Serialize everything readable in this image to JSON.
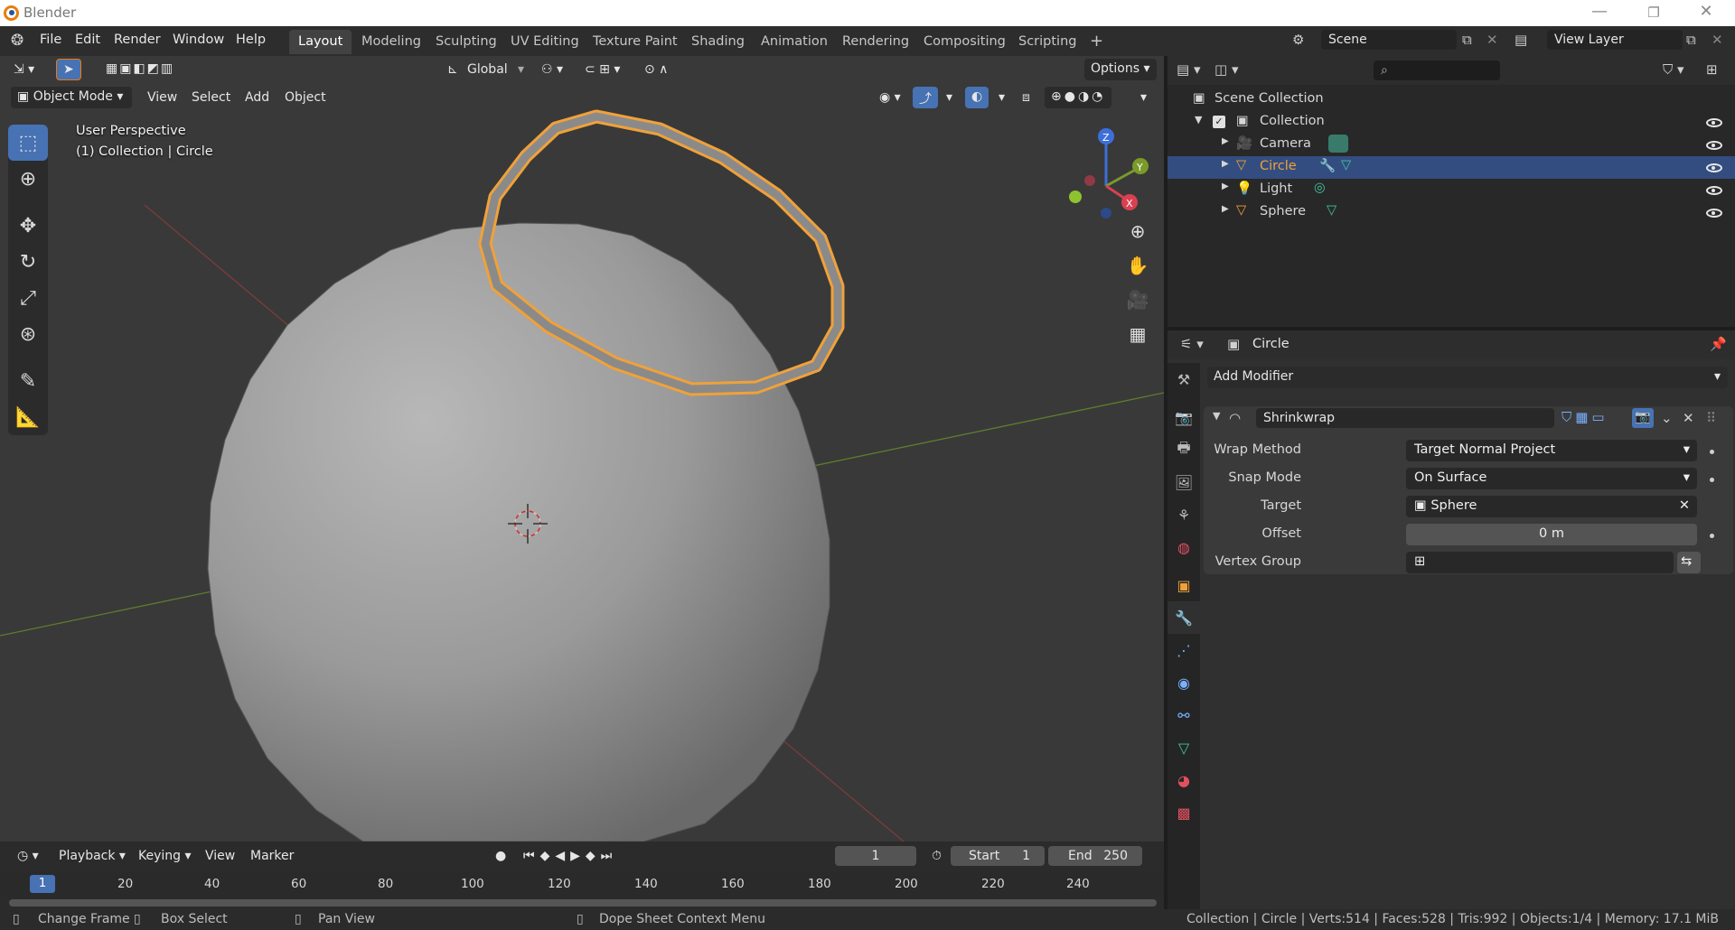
{
  "window": {
    "title": "Blender",
    "minimize": "—",
    "maximize": "❐",
    "close": "✕"
  },
  "topmenu": [
    "File",
    "Edit",
    "Render",
    "Window",
    "Help"
  ],
  "workspace_tabs": [
    "Layout",
    "Modeling",
    "Sculpting",
    "UV Editing",
    "Texture Paint",
    "Shading",
    "Animation",
    "Rendering",
    "Compositing",
    "Scripting"
  ],
  "add_workspace": "+",
  "scene": {
    "label": "Scene",
    "view_layer": "View Layer"
  },
  "viewport_header": {
    "transform_orientation": "Global",
    "options": "Options",
    "mode": "Object Mode",
    "menus": [
      "View",
      "Select",
      "Add",
      "Object"
    ]
  },
  "overlay": {
    "perspective": "User Perspective",
    "context": "(1) Collection | Circle"
  },
  "gizmo": {
    "z": "Z",
    "y": "Y",
    "x": "X"
  },
  "timeline": {
    "menus": [
      "Playback",
      "Keying",
      "View",
      "Marker"
    ],
    "current_frame": "1",
    "start_label": "Start",
    "start": "1",
    "end_label": "End",
    "end": "250",
    "ruler": [
      "1",
      "20",
      "40",
      "60",
      "80",
      "100",
      "120",
      "140",
      "160",
      "180",
      "200",
      "220",
      "240"
    ]
  },
  "statusbar": {
    "left": [
      "Change Frame",
      "Box Select",
      "Pan View",
      "Dope Sheet Context Menu"
    ],
    "right": "Collection | Circle | Verts:514 | Faces:528 | Tris:992 | Objects:1/4 | Memory: 17.1 MiB"
  },
  "outliner": {
    "scene_collection": "Scene Collection",
    "collection": "Collection",
    "items": [
      "Camera",
      "Circle",
      "Light",
      "Sphere"
    ],
    "selected": "Circle"
  },
  "properties": {
    "object_name": "Circle",
    "add_modifier": "Add Modifier",
    "modifier": {
      "name": "Shrinkwrap",
      "wrap_method_label": "Wrap Method",
      "wrap_method": "Target Normal Project",
      "snap_mode_label": "Snap Mode",
      "snap_mode": "On Surface",
      "target_label": "Target",
      "target": "Sphere",
      "offset_label": "Offset",
      "offset": "0 m",
      "vertex_group_label": "Vertex Group",
      "vertex_group": ""
    }
  },
  "colors": {
    "accent": "#4772b3",
    "selected_row": "#334d80",
    "outline": "#f0a13a",
    "header": "#2d2d2d"
  }
}
